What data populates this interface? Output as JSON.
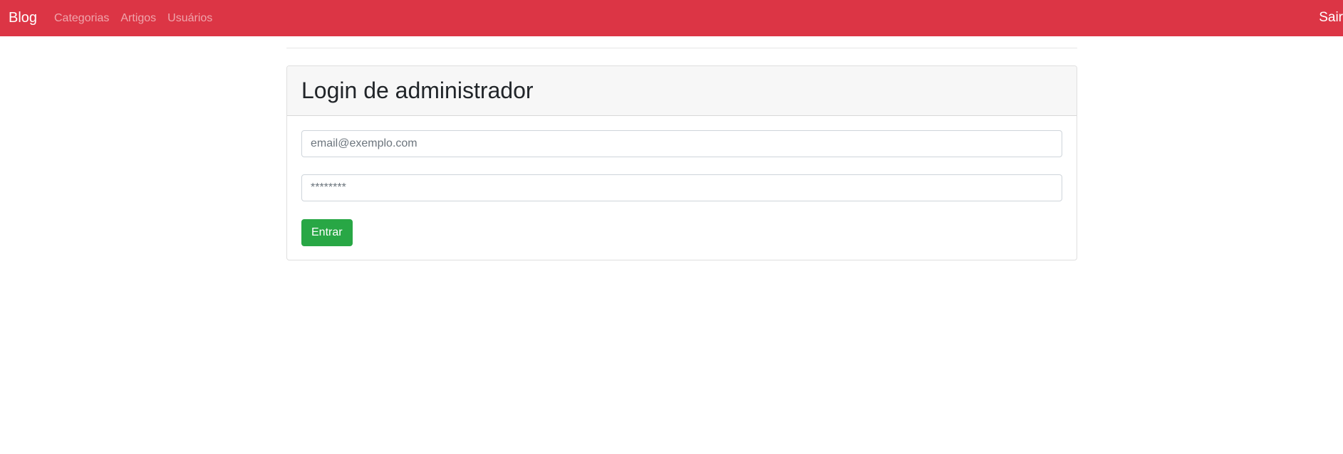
{
  "navbar": {
    "brand": "Blog",
    "links": [
      "Categorias",
      "Artigos",
      "Usuários"
    ],
    "right_link": "Sair",
    "color": "#dc3545"
  },
  "login_card": {
    "title": "Login de administrador",
    "email_placeholder": "email@exemplo.com",
    "password_placeholder": "********",
    "submit_label": "Entrar",
    "submit_color": "#28a745"
  }
}
